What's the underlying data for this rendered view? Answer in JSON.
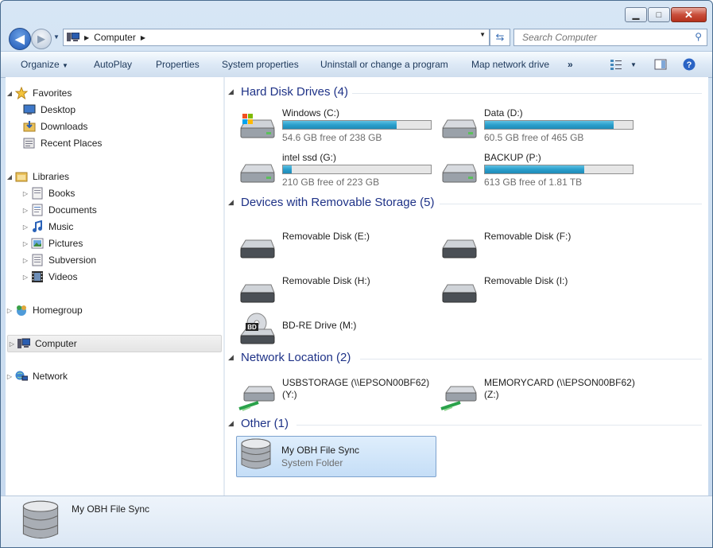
{
  "window": {
    "caption_buttons": [
      "minimize",
      "maximize",
      "close"
    ]
  },
  "address": {
    "crumb": "Computer"
  },
  "search": {
    "placeholder": "Search Computer"
  },
  "toolbar": {
    "organize": "Organize",
    "autoplay": "AutoPlay",
    "properties": "Properties",
    "system_properties": "System properties",
    "uninstall": "Uninstall or change a program",
    "map_drive": "Map network drive",
    "more": "»"
  },
  "nav": {
    "favorites": "Favorites",
    "desktop": "Desktop",
    "downloads": "Downloads",
    "recent": "Recent Places",
    "libraries": "Libraries",
    "books": "Books",
    "documents": "Documents",
    "music": "Music",
    "pictures": "Pictures",
    "subversion": "Subversion",
    "videos": "Videos",
    "homegroup": "Homegroup",
    "computer": "Computer",
    "network": "Network"
  },
  "groups": {
    "hdd": "Hard Disk Drives (4)",
    "removable": "Devices with Removable Storage (5)",
    "network": "Network Location (2)",
    "other": "Other (1)"
  },
  "drives": {
    "c": {
      "name": "Windows (C:)",
      "free": "54.6 GB free of 238 GB",
      "used_fraction": 0.77
    },
    "d": {
      "name": "Data (D:)",
      "free": "60.5 GB free of 465 GB",
      "used_fraction": 0.87
    },
    "g": {
      "name": "intel ssd (G:)",
      "free": "210 GB free of 223 GB",
      "used_fraction": 0.06
    },
    "p": {
      "name": "BACKUP (P:)",
      "free": "613 GB free of 1.81 TB",
      "used_fraction": 0.67
    }
  },
  "removable": {
    "e": "Removable Disk (E:)",
    "f": "Removable Disk (F:)",
    "h": "Removable Disk (H:)",
    "i": "Removable Disk (I:)",
    "m": "BD-RE Drive (M:)",
    "bd_badge": "BD"
  },
  "network_locs": {
    "y1": "USBSTORAGE (\\\\EPSON00BF62)",
    "y2": "(Y:)",
    "z1": "MEMORYCARD (\\\\EPSON00BF62)",
    "z2": "(Z:)"
  },
  "other": {
    "name": "My OBH File Sync",
    "sub": "System Folder"
  },
  "details": {
    "name": "My OBH File Sync"
  }
}
